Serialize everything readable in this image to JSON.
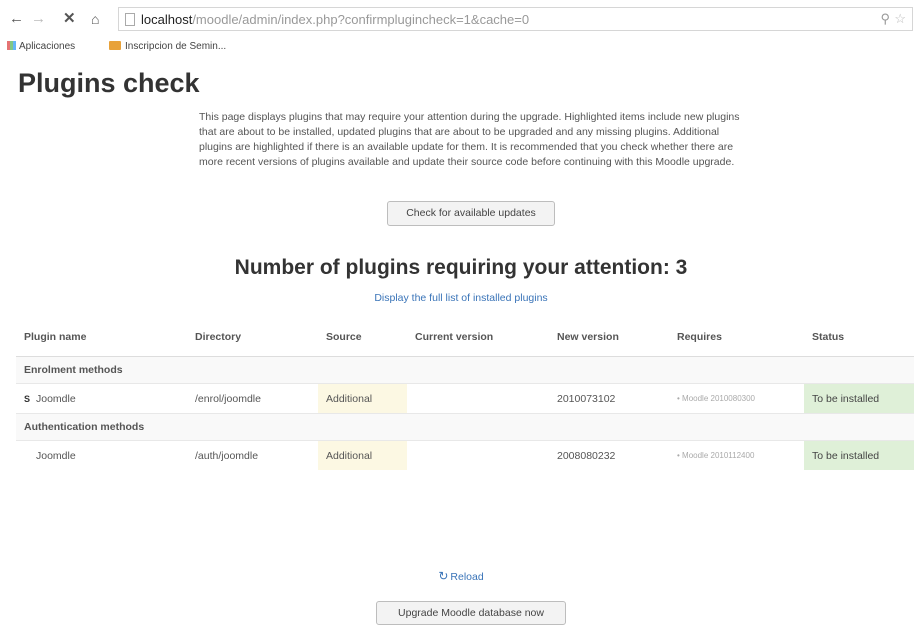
{
  "browser": {
    "url_host": "localhost",
    "url_path": "/moodle/admin/index.php?confirmplugincheck=1&cache=0",
    "bookmarks": [
      "Aplicaciones",
      "Inscripcion de Semin..."
    ]
  },
  "page": {
    "title": "Plugins check",
    "intro": "This page displays plugins that may require your attention during the upgrade. Highlighted items include new plugins that are about to be installed, updated plugins that are about to be upgraded and any missing plugins. Additional plugins are highlighted if there is an available update for them. It is recommended that you check whether there are more recent versions of plugins available and update their source code before continuing with this Moodle upgrade.",
    "check_button": "Check for available updates",
    "attention_heading": "Number of plugins requiring your attention: 3",
    "full_list_link": "Display the full list of installed plugins",
    "reload_link": "Reload",
    "upgrade_button": "Upgrade Moodle database now"
  },
  "table": {
    "headers": [
      "Plugin name",
      "Directory",
      "Source",
      "Current version",
      "New version",
      "Requires",
      "Status"
    ],
    "groups": [
      {
        "name": "Enrolment methods",
        "rows": [
          {
            "name": "Joomdle",
            "directory": "/enrol/joomdle",
            "source": "Additional",
            "current": "",
            "new": "2010073102",
            "requires": "Moodle 2010080300",
            "status": "To be installed"
          }
        ]
      },
      {
        "name": "Authentication methods",
        "rows": [
          {
            "name": "Joomdle",
            "directory": "/auth/joomdle",
            "source": "Additional",
            "current": "",
            "new": "2008080232",
            "requires": "Moodle 2010112400",
            "status": "To be installed"
          }
        ]
      }
    ]
  }
}
